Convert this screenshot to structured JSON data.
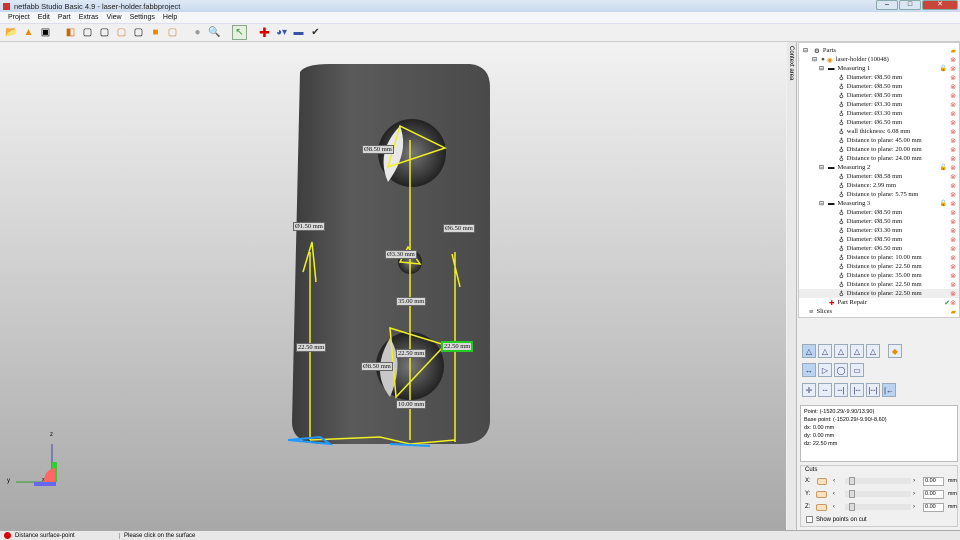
{
  "window": {
    "title": "netfabb Studio Basic 4.9 - laser-holder.fabbproject",
    "controls": [
      "–",
      "□",
      "✕"
    ]
  },
  "menu": [
    "Project",
    "Edit",
    "Part",
    "Extras",
    "View",
    "Settings",
    "Help"
  ],
  "toolbar": {
    "icons": [
      "open-project-icon",
      "add-part-icon",
      "screenshot-icon",
      "view-default-icon",
      "view-front-icon",
      "view-back-icon",
      "view-left-icon",
      "view-right-icon",
      "view-top-icon",
      "view-bottom-icon",
      "shading-icon",
      "zoom-icon",
      "select-pointer-icon",
      "repair-icon",
      "analysis-icon",
      "measure-icon",
      "apply-check-icon"
    ]
  },
  "viewport": {
    "labels": [
      "Ø8.50 mm",
      "Ø1.50 mm",
      "Ø6.50 mm",
      "Ø3.30 mm",
      "35.00 mm",
      "22.50 mm",
      "22.50 mm",
      "22.50 mm",
      "Ø8.50 mm",
      "10.00 mm"
    ],
    "axes": {
      "z": "z",
      "y": "y",
      "x": "x"
    }
  },
  "context_tab": "Context area",
  "tree": {
    "root": "Parts",
    "part": "laser-holder (10048)",
    "groups": [
      {
        "name": "Measuring 1",
        "items": [
          "Diameter: Ø8.50 mm",
          "Diameter: Ø8.50 mm",
          "Diameter: Ø8.50 mm",
          "Diameter: Ø3.30 mm",
          "Diameter: Ø3.30 mm",
          "Diameter: Ø6.50 mm",
          "wall thickness: 6.08 mm",
          "Distance to plane: 45.00 mm",
          "Distance to plane: 20.00 mm",
          "Distance to plane: 24.00 mm"
        ]
      },
      {
        "name": "Measuring 2",
        "items": [
          "Diameter: Ø8.58 mm",
          "Distance: 2.99 mm",
          "Distance to plane: 5.75 mm"
        ]
      },
      {
        "name": "Measuring 3",
        "items": [
          "Diameter: Ø8.50 mm",
          "Diameter: Ø8.50 mm",
          "Diameter: Ø3.30 mm",
          "Diameter: Ø8.50 mm",
          "Diameter: Ø6.50 mm",
          "Distance to plane: 10.00 mm",
          "Distance to plane: 22.50 mm",
          "Distance to plane: 35.00 mm",
          "Distance to plane: 22.50 mm",
          "Distance to plane: 22.50 mm"
        ]
      }
    ],
    "repair": "Part Repair",
    "slices": "Slices"
  },
  "info": {
    "point": "Point: (-1520.29/-9.90/13.90)",
    "base": "Base point: (-1520.29/-9.90/-8.60)",
    "dx": "dx: 0.00 mm",
    "dy": "dy: 0.00 mm",
    "dz": "dz: 22.50 mm"
  },
  "cuts": {
    "title": "Cuts",
    "rows": [
      {
        "axis": "X:",
        "value": "0.00",
        "unit": "mm"
      },
      {
        "axis": "Y:",
        "value": "0.00",
        "unit": "mm"
      },
      {
        "axis": "Z:",
        "value": "0.00",
        "unit": "mm"
      }
    ],
    "show_points": "Show points on cut",
    "show_points_checked": false
  },
  "status": {
    "mode": "Distance surface-point",
    "hint": "Please click on the surface"
  },
  "colors": {
    "measure": "#f0f020",
    "active_label": "#22cc22",
    "model": "#505050"
  }
}
